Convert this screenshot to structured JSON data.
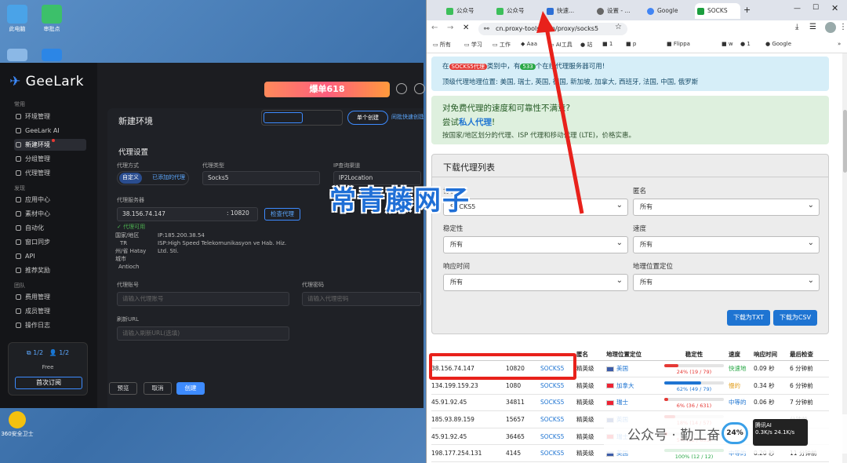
{
  "desktop": {
    "icons": [
      "此电脑",
      "审批点",
      "",
      "",
      "360安全卫士"
    ]
  },
  "geelark": {
    "logo": "GeeLark",
    "banner": "爆单618",
    "sidebar": {
      "groups": [
        "常用",
        "发现",
        "团队"
      ],
      "items": [
        "环境管理",
        "GeeLark AI",
        "新建环境",
        "分组管理",
        "代理管理",
        "应用中心",
        "素材中心",
        "自动化",
        "窗口同步",
        "API",
        "推荐奖励",
        "费用管理",
        "成员管理",
        "操作日志"
      ],
      "plan": {
        "a": "1/2",
        "b": "1/2",
        "tier": "Free",
        "cta": "首次订阅"
      }
    },
    "title": "新建环境",
    "mode": {
      "single": "单个创建",
      "batch": "同批快速创建"
    },
    "section": "代理设置",
    "proxy_method_label": "代理方式",
    "proxy_method_a": "自定义",
    "proxy_method_b": "已添加的代理",
    "proxy_type_label": "代理类型",
    "proxy_type": "Socks5",
    "ip_source_label": "IP查询渠道",
    "ip_source": "IP2Location",
    "server_label": "代理服务器",
    "server_ip": "38.156.74.147",
    "server_port": ": 10820",
    "check_btn": "检查代理",
    "check_ok": "代理可用",
    "info_k": [
      "国家/地区",
      "TR",
      "州/省 Hatay",
      "城市",
      "Antioch"
    ],
    "info_ip": "IP:185.200.38.54",
    "info_isp": "ISP:High Speed Telekomunikasyon ve Hab. Hiz. Ltd. Sti.",
    "account_label": "代理账号",
    "account_ph": "请输入代理账号",
    "password_label": "代理密码",
    "password_ph": "请输入代理密码",
    "refresh_label": "刷新URL",
    "refresh_ph": "请输入刷新URL(选填)",
    "btn_preview": "预览",
    "btn_cancel": "取消",
    "btn_create": "创建"
  },
  "watermark": "常青藤网子",
  "chrome": {
    "tabs": [
      "公众号",
      "公众号",
      "快速...",
      "设置 - ...",
      "Google",
      "SOCKS"
    ],
    "url": "cn.proxy-tools.com/proxy/socks5",
    "bookmarks": [
      "所有",
      "学习",
      "工作",
      "Aaa",
      "AI工具",
      "站",
      "1",
      "p",
      "Flippa",
      "w",
      "1",
      "Google"
    ],
    "alert1_pre": "在",
    "alert1_badge": "SOCKS5代理",
    "alert1_mid": "类别中，有",
    "alert1_count": "533",
    "alert1_post": "个在线代理服务器可用!",
    "alert1_line2": "顶级代理地理位置: 美国, 瑞士, 英国, 德国, 新加坡, 加拿大, 西班牙, 法国, 中国, 俄罗斯",
    "alert2_title": "对免费代理的速度和可靠性不满意?",
    "alert2_try": "尝试",
    "alert2_link": "私人代理",
    "alert2_excl": "!",
    "alert2_desc": "按国家/地区划分的代理、ISP 代理和移动代理 (LTE)，价格实惠。",
    "card_title": "下载代理列表",
    "f_protocol_label": "协议",
    "f_protocol": "SOCKS5",
    "f_anon_label": "匿名",
    "f_anon": "所有",
    "f_stab_label": "稳定性",
    "f_stab": "所有",
    "f_speed_label": "速度",
    "f_speed": "所有",
    "f_resp_label": "响应时间",
    "f_resp": "所有",
    "f_geo_label": "地理位置定位",
    "f_geo": "所有",
    "btn_txt": "下载为TXT",
    "btn_csv": "下载为CSV",
    "table": {
      "headers": [
        "",
        "",
        "",
        "匿名",
        "地理位置定位",
        "稳定性",
        "速度",
        "响应时间",
        "最后检查"
      ],
      "rows": [
        {
          "ip": "38.156.74.147",
          "port": "10820",
          "proto": "SOCKS5",
          "anon": "精英级",
          "country": "美国",
          "stab": "24% (19 / 79)",
          "stab_pct": 24,
          "speed": "快速地",
          "resp": "0.09 秒",
          "last": "6 分钟前"
        },
        {
          "ip": "134.199.159.23",
          "port": "1080",
          "proto": "SOCKS5",
          "anon": "精英级",
          "country": "加拿大",
          "stab": "62% (49 / 79)",
          "stab_pct": 62,
          "speed": "慢的",
          "resp": "0.34 秒",
          "last": "6 分钟前"
        },
        {
          "ip": "45.91.92.45",
          "port": "34811",
          "proto": "SOCKS5",
          "anon": "精英级",
          "country": "瑞士",
          "stab": "6% (36 / 631)",
          "stab_pct": 6,
          "speed": "中等的",
          "resp": "0.06 秒",
          "last": "7 分钟前"
        },
        {
          "ip": "185.93.89.159",
          "port": "15657",
          "proto": "SOCKS5",
          "anon": "精英级",
          "country": "英国",
          "stab": "18% (14 / 57)",
          "stab_pct": 18,
          "speed": "",
          "resp": "",
          "last": "分钟前"
        },
        {
          "ip": "45.91.92.45",
          "port": "36465",
          "proto": "SOCKS5",
          "anon": "精英级",
          "country": "瑞士",
          "stab": "5% (32 / 653)",
          "stab_pct": 5,
          "speed": "",
          "resp": "",
          "last": "分钟前"
        },
        {
          "ip": "198.177.254.131",
          "port": "4145",
          "proto": "SOCKS5",
          "anon": "精英级",
          "country": "美国",
          "stab": "100% (12 / 12)",
          "stab_pct": 100,
          "speed": "中等的",
          "resp": "0.20 秒",
          "last": "11 分钟前"
        }
      ]
    }
  },
  "overlay": {
    "wechat": "公众号 · 勤工奋",
    "net_pct": "24%",
    "net_label": "腾讯AI",
    "up": "0.3K/s",
    "down": "24.1K/s"
  }
}
